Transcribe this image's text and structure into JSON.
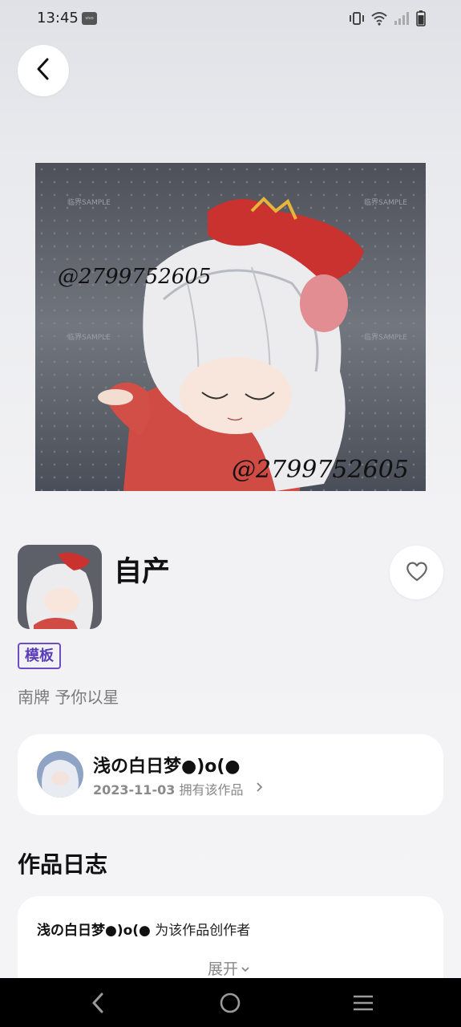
{
  "status_bar": {
    "time": "13:45",
    "badge_text": "vivo",
    "icons": [
      "vibrate-icon",
      "wifi-icon",
      "signal-icon",
      "battery-icon"
    ]
  },
  "header": {
    "back_icon": "chevron-left-icon"
  },
  "artwork": {
    "watermark_handle": "@2799752605",
    "watermark_sample": "临界SAMPLE",
    "title": "自产",
    "tag": "模板",
    "subtitle": "南牌 予你以星"
  },
  "owner": {
    "name": "浅の白日梦●)o(●",
    "date": "2023-11-03",
    "meta": "拥有该作品"
  },
  "log": {
    "section_title": "作品日志",
    "entry_name": "浅の白日梦●)o(●",
    "entry_text": " 为该作品创作者",
    "expand_label": "展开"
  },
  "colors": {
    "tag_border": "#6c4dc4",
    "card_bg": "#ffffff",
    "nav_bg": "#000000"
  }
}
